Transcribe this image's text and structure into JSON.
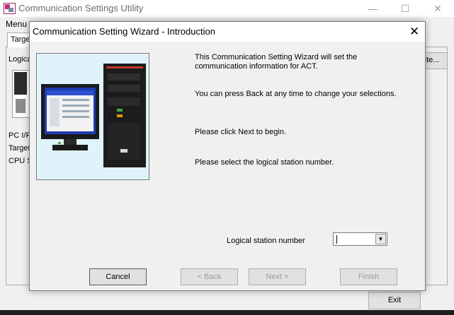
{
  "background_window": {
    "title": "Communication Settings Utility",
    "menu_label": "Menu",
    "tab_label": "Targe",
    "logical_label": "Logica",
    "left_labels": [
      "PC I/F",
      "Target",
      "CPU S"
    ],
    "right_button_label": "ete...",
    "exit_button_label": "Exit",
    "caption_minimize": "—",
    "caption_maximize": "☐",
    "caption_close": "✕"
  },
  "dialog": {
    "title": "Communication Setting Wizard - Introduction",
    "close_glyph": "✕",
    "intro_paragraphs": [
      "This Communication Setting Wizard will set the communication information for ACT.",
      "You can press Back at any time to change your selections.",
      "Please click Next to begin.",
      "Please select the logical station number."
    ],
    "logical_station": {
      "label": "Logical station number",
      "value": ""
    },
    "buttons": {
      "cancel": "Cancel",
      "back": "< Back",
      "next": "Next >",
      "finish": "Finish"
    },
    "dropdown_glyph": "▼"
  }
}
